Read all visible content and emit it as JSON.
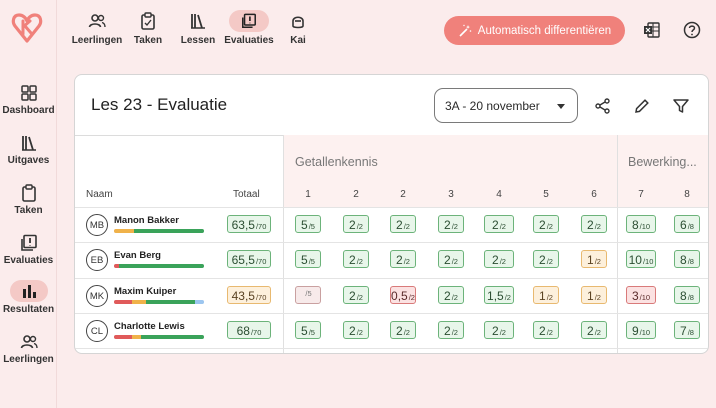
{
  "topnav": {
    "items": [
      {
        "label": "Leerlingen",
        "icon": "users-icon"
      },
      {
        "label": "Taken",
        "icon": "clipboard-icon"
      },
      {
        "label": "Lessen",
        "icon": "books-icon"
      },
      {
        "label": "Evaluaties",
        "icon": "evaluation-icon"
      },
      {
        "label": "Kai",
        "icon": "robot-icon"
      }
    ],
    "auto_button": "Automatisch differentiëren"
  },
  "sidebar": {
    "items": [
      {
        "label": "Dashboard",
        "icon": "grid-icon"
      },
      {
        "label": "Uitgaves",
        "icon": "books-icon"
      },
      {
        "label": "Taken",
        "icon": "clipboard-icon"
      },
      {
        "label": "Evaluaties",
        "icon": "evaluation-icon"
      },
      {
        "label": "Resultaten",
        "icon": "bar-chart-icon"
      },
      {
        "label": "Leerlingen",
        "icon": "users-icon"
      }
    ]
  },
  "card": {
    "title": "Les 23 - Evaluatie",
    "class_select": "3A - 20 november"
  },
  "table": {
    "name_header": "Naam",
    "total_header": "Totaal",
    "groups": [
      "Getallenkennis",
      "Bewerking..."
    ],
    "columns": [
      "1",
      "2",
      "2",
      "3",
      "4",
      "5",
      "6",
      "7",
      "8"
    ],
    "students": [
      {
        "initials": "MB",
        "name": "Manon Bakker",
        "total": {
          "val": "63,5",
          "den": "/70",
          "status": "green"
        },
        "progress": {
          "red": 0.0,
          "orange": 0.22,
          "green": 0.78,
          "blue": 0.0
        },
        "scores": [
          {
            "val": "5",
            "den": "/5",
            "status": "green"
          },
          {
            "val": "2",
            "den": "/2",
            "status": "green"
          },
          {
            "val": "2",
            "den": "/2",
            "status": "green"
          },
          {
            "val": "2",
            "den": "/2",
            "status": "green"
          },
          {
            "val": "2",
            "den": "/2",
            "status": "green"
          },
          {
            "val": "2",
            "den": "/2",
            "status": "green"
          },
          {
            "val": "2",
            "den": "/2",
            "status": "green"
          },
          {
            "val": "8",
            "den": "/10",
            "status": "green"
          },
          {
            "val": "6",
            "den": "/8",
            "status": "green"
          }
        ]
      },
      {
        "initials": "EB",
        "name": "Evan Berg",
        "total": {
          "val": "65,5",
          "den": "/70",
          "status": "green"
        },
        "progress": {
          "red": 0.06,
          "orange": 0.0,
          "green": 0.94,
          "blue": 0.0
        },
        "scores": [
          {
            "val": "5",
            "den": "/5",
            "status": "green"
          },
          {
            "val": "2",
            "den": "/2",
            "status": "green"
          },
          {
            "val": "2",
            "den": "/2",
            "status": "green"
          },
          {
            "val": "2",
            "den": "/2",
            "status": "green"
          },
          {
            "val": "2",
            "den": "/2",
            "status": "green"
          },
          {
            "val": "2",
            "den": "/2",
            "status": "green"
          },
          {
            "val": "1",
            "den": "/2",
            "status": "orange"
          },
          {
            "val": "10",
            "den": "/10",
            "status": "green"
          },
          {
            "val": "8",
            "den": "/8",
            "status": "green"
          }
        ]
      },
      {
        "initials": "MK",
        "name": "Maxim Kuiper",
        "total": {
          "val": "43,5",
          "den": "/70",
          "status": "orange"
        },
        "progress": {
          "red": 0.2,
          "orange": 0.16,
          "green": 0.54,
          "blue": 0.1
        },
        "scores": [
          {
            "val": "",
            "den": "/5",
            "status": "empty"
          },
          {
            "val": "2",
            "den": "/2",
            "status": "green"
          },
          {
            "val": "0,5",
            "den": "/2",
            "status": "red"
          },
          {
            "val": "2",
            "den": "/2",
            "status": "green"
          },
          {
            "val": "1,5",
            "den": "/2",
            "status": "green"
          },
          {
            "val": "1",
            "den": "/2",
            "status": "orange"
          },
          {
            "val": "1",
            "den": "/2",
            "status": "orange"
          },
          {
            "val": "3",
            "den": "/10",
            "status": "red"
          },
          {
            "val": "8",
            "den": "/8",
            "status": "green"
          }
        ]
      },
      {
        "initials": "CL",
        "name": "Charlotte Lewis",
        "total": {
          "val": "68",
          "den": "/70",
          "status": "green"
        },
        "progress": {
          "red": 0.2,
          "orange": 0.1,
          "green": 0.7,
          "blue": 0.0
        },
        "scores": [
          {
            "val": "5",
            "den": "/5",
            "status": "green"
          },
          {
            "val": "2",
            "den": "/2",
            "status": "green"
          },
          {
            "val": "2",
            "den": "/2",
            "status": "green"
          },
          {
            "val": "2",
            "den": "/2",
            "status": "green"
          },
          {
            "val": "2",
            "den": "/2",
            "status": "green"
          },
          {
            "val": "2",
            "den": "/2",
            "status": "green"
          },
          {
            "val": "2",
            "den": "/2",
            "status": "green"
          },
          {
            "val": "9",
            "den": "/10",
            "status": "green"
          },
          {
            "val": "7",
            "den": "/8",
            "status": "green"
          }
        ]
      }
    ]
  },
  "colors": {
    "accent": "#f0817b",
    "bg": "#fbecec",
    "pill": "#f4c9c6",
    "progress_red": "#e05a5a",
    "progress_orange": "#f0b24a",
    "progress_green": "#3aa35a",
    "progress_blue": "#9cc6f0"
  }
}
